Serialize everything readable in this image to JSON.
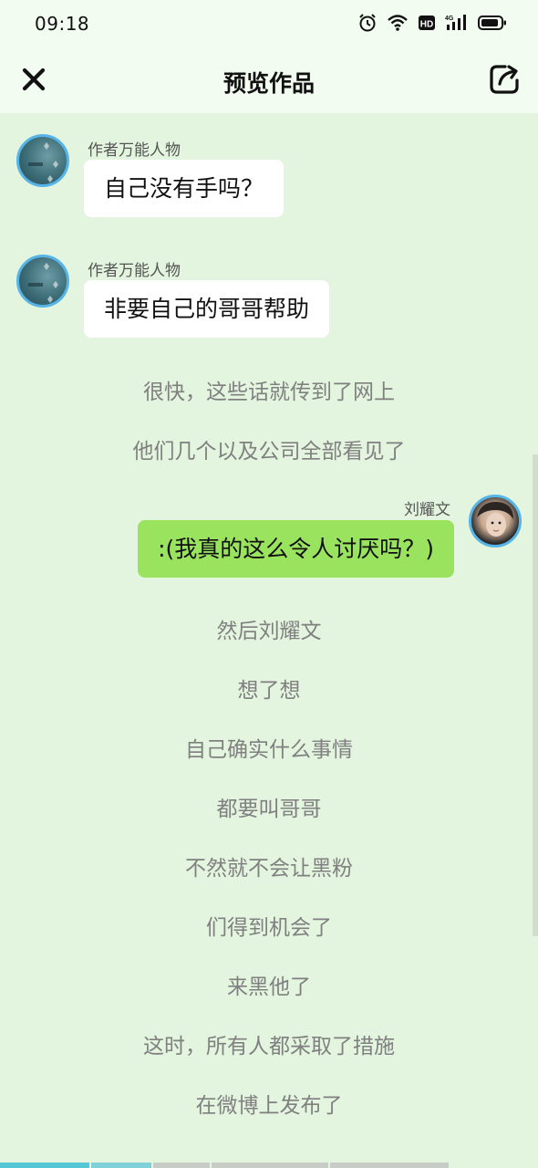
{
  "status_bar": {
    "time": "09:18",
    "icons": [
      "alarm-icon",
      "wifi-icon",
      "hd-icon",
      "signal-4g-icon",
      "battery-icon"
    ]
  },
  "header": {
    "title": "预览作品",
    "close_icon": "close-icon",
    "share_icon": "share-icon"
  },
  "messages": [
    {
      "type": "chat",
      "side": "left",
      "name": "作者万能人物",
      "text": "自己没有手吗？"
    },
    {
      "type": "chat",
      "side": "left",
      "name": "作者万能人物",
      "text": "非要自己的哥哥帮助"
    },
    {
      "type": "narration",
      "text": "很快，这些话就传到了网上"
    },
    {
      "type": "narration",
      "text": "他们几个以及公司全部看见了"
    },
    {
      "type": "chat",
      "side": "right",
      "name": "刘耀文",
      "text": ":(我真的这么令人讨厌吗？)"
    },
    {
      "type": "narration",
      "text": "然后刘耀文"
    },
    {
      "type": "narration",
      "text": "想了想"
    },
    {
      "type": "narration",
      "text": "自己确实什么事情"
    },
    {
      "type": "narration",
      "text": "都要叫哥哥"
    },
    {
      "type": "narration",
      "text": "不然就不会让黑粉"
    },
    {
      "type": "narration",
      "text": "们得到机会了"
    },
    {
      "type": "narration",
      "text": "来黑他了"
    },
    {
      "type": "narration",
      "text": "这时，所有人都采取了措施"
    },
    {
      "type": "narration",
      "text": "在微博上发布了"
    }
  ],
  "colors": {
    "background": "#e3f4df",
    "header_bg": "#f2fcf0",
    "right_bubble": "#9ae35f",
    "left_bubble": "#ffffff",
    "avatar_ring": "#56b4e6",
    "narration_text": "#808080"
  }
}
